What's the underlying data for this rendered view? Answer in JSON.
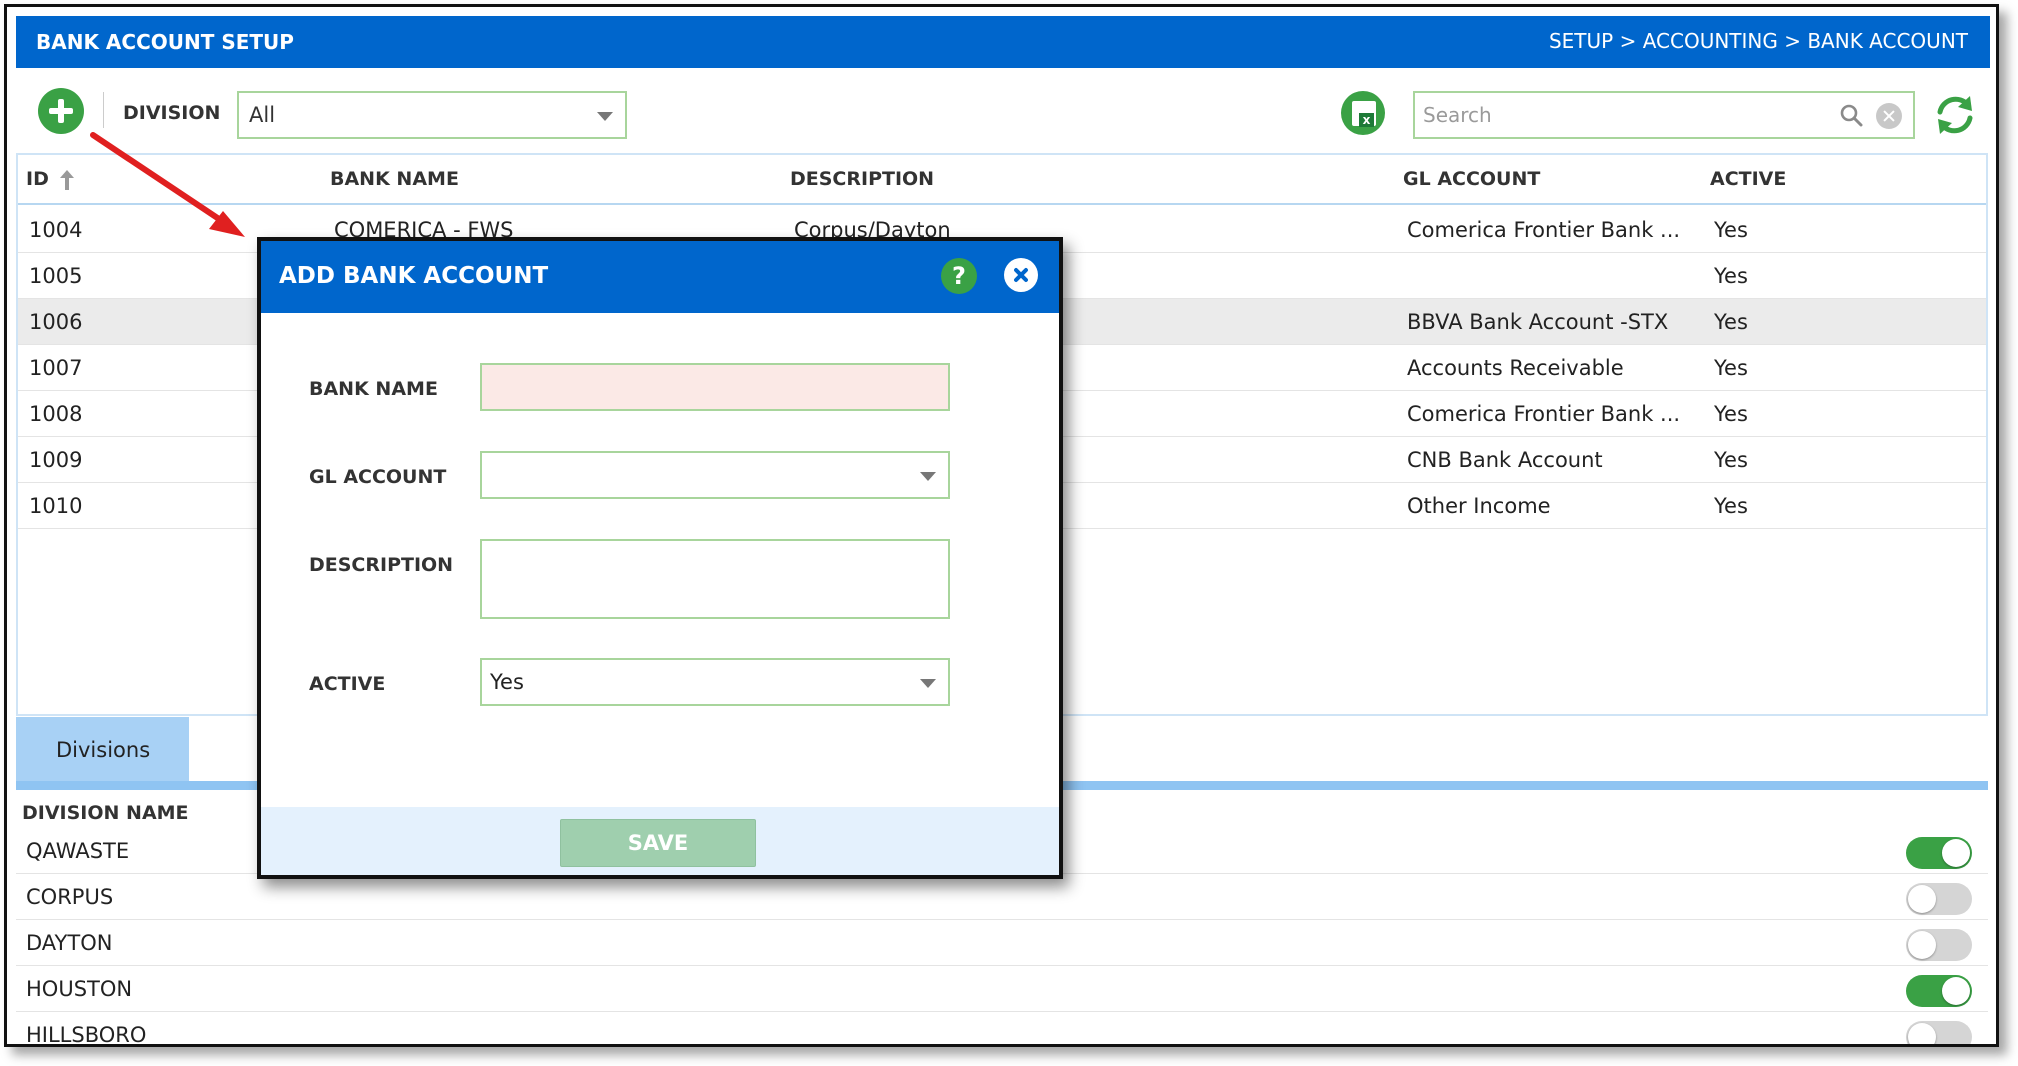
{
  "header": {
    "title": "BANK ACCOUNT SETUP",
    "breadcrumb": "SETUP > ACCOUNTING > BANK ACCOUNT"
  },
  "toolbar": {
    "division_label": "DIVISION",
    "division_value": "All",
    "search_placeholder": "Search"
  },
  "grid": {
    "columns": {
      "id": "ID",
      "bank_name": "BANK NAME",
      "description": "DESCRIPTION",
      "gl_account": "GL ACCOUNT",
      "active": "ACTIVE"
    },
    "rows": [
      {
        "id": "1004",
        "bank_name": "COMERICA - FWS",
        "description": "Corpus/Dayton",
        "gl_account": "Comerica Frontier Bank ...",
        "active": "Yes"
      },
      {
        "id": "1005",
        "bank_name": "",
        "description": "",
        "gl_account": "",
        "active": "Yes"
      },
      {
        "id": "1006",
        "bank_name": "",
        "description": "",
        "gl_account": "BBVA Bank Account -STX",
        "active": "Yes"
      },
      {
        "id": "1007",
        "bank_name": "",
        "description": "",
        "gl_account": "Accounts Receivable",
        "active": "Yes"
      },
      {
        "id": "1008",
        "bank_name": "",
        "description": "",
        "gl_account": "Comerica Frontier Bank ...",
        "active": "Yes"
      },
      {
        "id": "1009",
        "bank_name": "",
        "description": "",
        "gl_account": "CNB Bank Account",
        "active": "Yes"
      },
      {
        "id": "1010",
        "bank_name": "",
        "description": "",
        "gl_account": "Other Income",
        "active": "Yes"
      }
    ]
  },
  "tabs": {
    "divisions": "Divisions"
  },
  "divisions": {
    "header": "DIVISION NAME",
    "items": [
      {
        "name": "QAWASTE",
        "enabled": true
      },
      {
        "name": "CORPUS",
        "enabled": false
      },
      {
        "name": "DAYTON",
        "enabled": false
      },
      {
        "name": "HOUSTON",
        "enabled": true
      },
      {
        "name": "HILLSBORO",
        "enabled": false
      }
    ]
  },
  "modal": {
    "title": "ADD BANK ACCOUNT",
    "help_glyph": "?",
    "bank_name_label": "BANK NAME",
    "bank_name_value": "",
    "gl_account_label": "GL ACCOUNT",
    "gl_account_value": "",
    "description_label": "DESCRIPTION",
    "description_value": "",
    "active_label": "ACTIVE",
    "active_value": "Yes",
    "save_label": "SAVE"
  },
  "colors": {
    "primary": "#0066cc",
    "accent_green": "#3aa145",
    "annotation_arrow": "#e02020"
  }
}
